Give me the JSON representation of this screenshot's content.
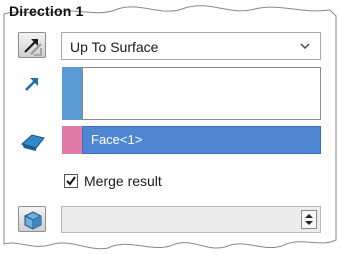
{
  "panel": {
    "title": "Direction 1",
    "end_condition": {
      "selected": "Up To Surface"
    },
    "direction_list": {
      "items": []
    },
    "face_selection": {
      "value": "Face<1>"
    },
    "merge_result": {
      "label": "Merge result",
      "checked": true
    },
    "offset": {
      "value": ""
    }
  },
  "colors": {
    "accent_blue": "#5c9ad6",
    "swatch_pink": "#e27aa7",
    "selection_blue": "#4f86d3",
    "icon_teal": "#1f6fa8"
  },
  "icons": {
    "reverse_direction": "reverse-direction-arrows-icon",
    "direction_vector": "direction-arrow-icon",
    "face_select": "face-selection-icon",
    "draft": "draft-cube-icon",
    "dropdown": "chevron-down-icon",
    "spinner": "spinner-arrows-icon"
  }
}
